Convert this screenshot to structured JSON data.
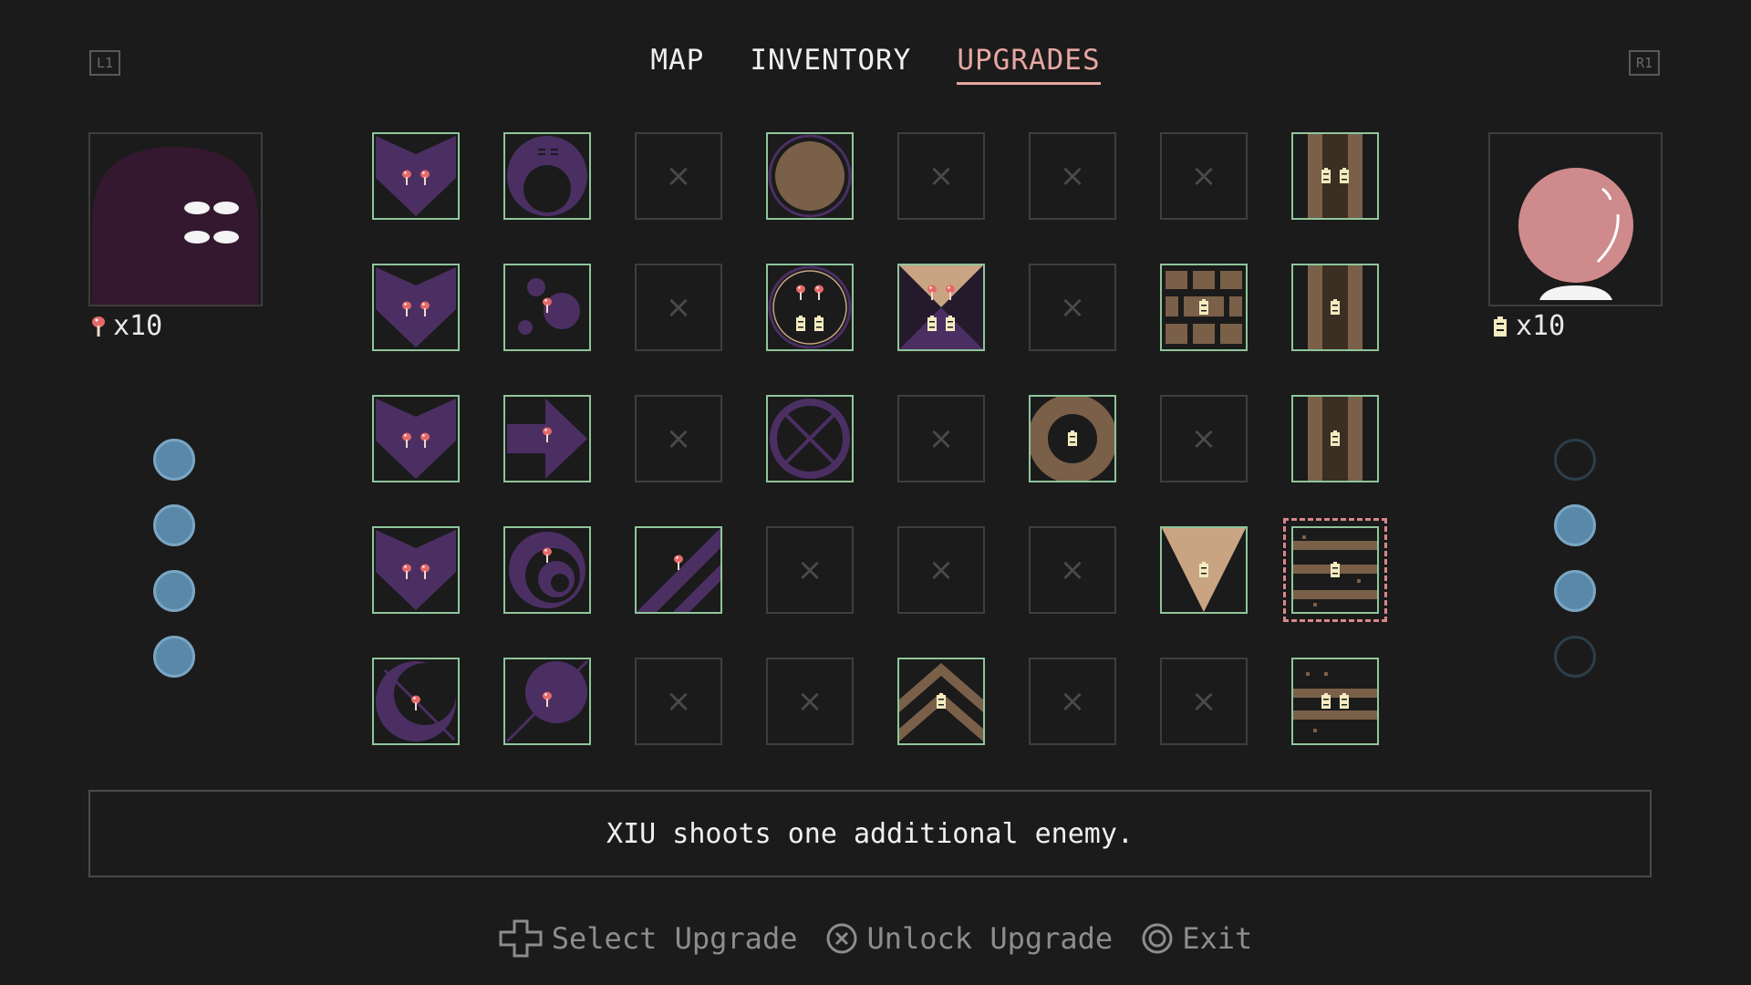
{
  "nav": {
    "left_shoulder": "L1",
    "right_shoulder": "R1",
    "tabs": [
      {
        "label": "MAP",
        "active": false
      },
      {
        "label": "INVENTORY",
        "active": false
      },
      {
        "label": "UPGRADES",
        "active": true
      }
    ]
  },
  "left_panel": {
    "character": "purple-ghost-xiu",
    "currency_icon": "mushroom-icon",
    "count": "x10",
    "filled_slots": 4,
    "total_slots": 4
  },
  "right_panel": {
    "character": "pink-orb",
    "currency_icon": "battery-icon",
    "count": "x10",
    "filled_slots": 2,
    "total_slots": 4
  },
  "grid": {
    "rows": 5,
    "cols": 8,
    "owned_border_color": "#8fc59b",
    "locked_symbol": "×",
    "selected": {
      "row": 4,
      "col": 8
    },
    "cells": [
      [
        "heart-2",
        "shell",
        "locked",
        "brown-circle",
        "locked",
        "locked",
        "locked",
        "pillar-2"
      ],
      [
        "heart-2",
        "bubbles",
        "locked",
        "ring-combo",
        "hourglass",
        "locked",
        "bricks",
        "pillar-1"
      ],
      [
        "heart-2",
        "arrow",
        "locked",
        "cross-circle",
        "locked",
        "donut",
        "locked",
        "pillar-1"
      ],
      [
        "heart-2",
        "spiral",
        "slash",
        "locked",
        "locked",
        "locked",
        "triangle",
        "rails"
      ],
      [
        "crescent",
        "moon-line",
        "locked",
        "locked",
        "chevrons",
        "locked",
        "locked",
        "rails-2"
      ]
    ]
  },
  "description": "XIU shoots one additional enemy.",
  "hints": [
    {
      "icon": "dpad-icon",
      "label": "Select Upgrade"
    },
    {
      "icon": "cross-button-icon",
      "label": "Unlock Upgrade"
    },
    {
      "icon": "circle-button-icon",
      "label": "Exit"
    }
  ],
  "colors": {
    "background": "#1b1b1b",
    "accent_pink": "#e7a7a2",
    "purple": "#4b2f63",
    "tan": "#c9a482",
    "brown": "#7a6048",
    "slot_blue": "#5a88a8"
  }
}
